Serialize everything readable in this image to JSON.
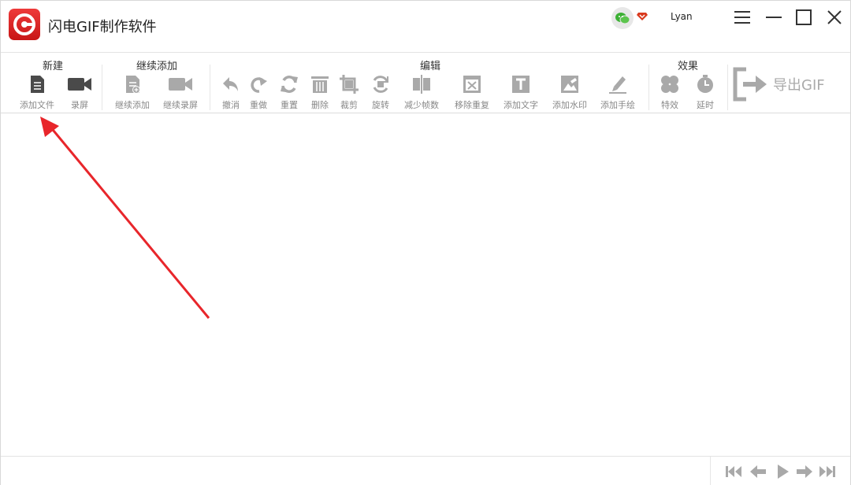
{
  "app": {
    "title": "闪电GIF制作软件",
    "accent_color": "#e02222",
    "icon_color": "#5a5a5a",
    "disabled_icon_color": "#aaaaaa"
  },
  "user": {
    "name": "Lyan"
  },
  "toolbar": {
    "groups": [
      {
        "label": "新建"
      },
      {
        "label": "继续添加"
      },
      {
        "label": "编辑"
      },
      {
        "label": "效果"
      }
    ],
    "tools": [
      {
        "label": "添加文件",
        "icon": "document-icon"
      },
      {
        "label": "录屏",
        "icon": "video-camera-icon"
      },
      {
        "label": "继续添加",
        "icon": "add-document-icon"
      },
      {
        "label": "继续录屏",
        "icon": "video-camera-icon"
      },
      {
        "label": "撤消",
        "icon": "undo-icon"
      },
      {
        "label": "重做",
        "icon": "redo-icon"
      },
      {
        "label": "重置",
        "icon": "reset-icon"
      },
      {
        "label": "删除",
        "icon": "trash-icon"
      },
      {
        "label": "裁剪",
        "icon": "crop-icon"
      },
      {
        "label": "旋转",
        "icon": "rotate-icon"
      },
      {
        "label": "减少帧数",
        "icon": "reduce-frames-icon"
      },
      {
        "label": "移除重复",
        "icon": "remove-duplicate-icon"
      },
      {
        "label": "添加文字",
        "icon": "text-icon"
      },
      {
        "label": "添加水印",
        "icon": "watermark-icon"
      },
      {
        "label": "添加手绘",
        "icon": "pen-icon"
      },
      {
        "label": "特效",
        "icon": "effects-icon"
      },
      {
        "label": "延时",
        "icon": "timer-icon"
      }
    ],
    "export_label": "导出GIF"
  }
}
